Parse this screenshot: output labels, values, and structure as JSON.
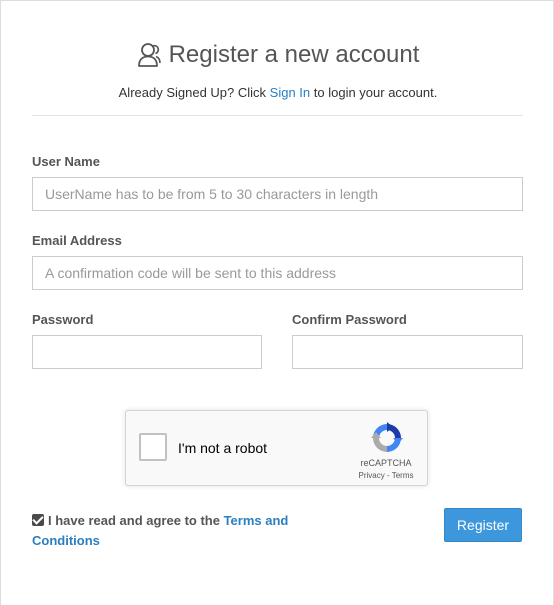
{
  "header": {
    "title": "Register a new account",
    "subtitle_prefix": "Already Signed Up? Click ",
    "signin_link": "Sign In",
    "subtitle_suffix": " to login your account."
  },
  "form": {
    "username": {
      "label": "User Name",
      "placeholder": "UserName has to be from 5 to 30 characters in length",
      "value": ""
    },
    "email": {
      "label": "Email Address",
      "placeholder": "A confirmation code will be sent to this address",
      "value": ""
    },
    "password": {
      "label": "Password",
      "placeholder": "",
      "value": ""
    },
    "confirm_password": {
      "label": "Confirm Password",
      "placeholder": "",
      "value": ""
    }
  },
  "captcha": {
    "label": "I'm not a robot",
    "brand": "reCAPTCHA",
    "links": "Privacy - Terms",
    "checked": false
  },
  "agreement": {
    "text": "I have read and agree to the ",
    "link": "Terms and Conditions",
    "checked": true
  },
  "actions": {
    "register_label": "Register"
  },
  "icons": {
    "title_icon": "user-outline-icon",
    "captcha_logo": "recaptcha-logo-icon"
  },
  "colors": {
    "link": "#2a7fc1",
    "button": "#3c97dd"
  }
}
